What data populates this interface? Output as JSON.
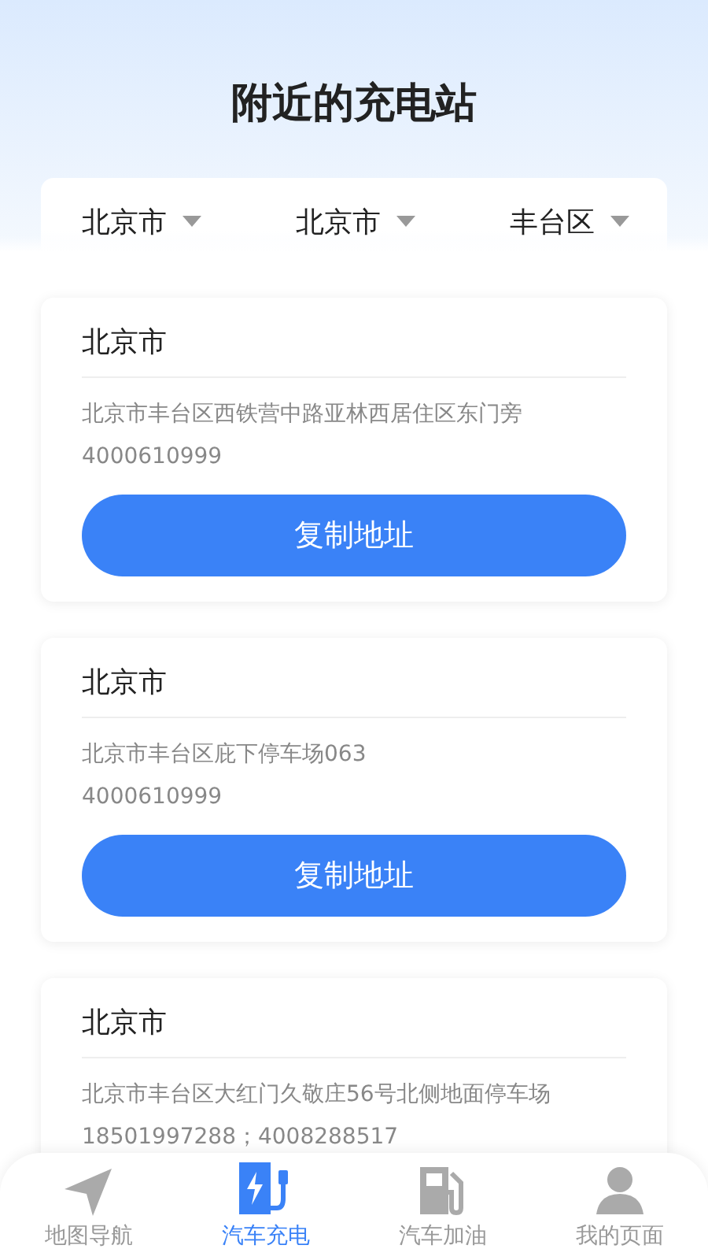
{
  "title": "附近的充电站",
  "filters": [
    {
      "label": "北京市"
    },
    {
      "label": "北京市"
    },
    {
      "label": "丰台区"
    }
  ],
  "stations": [
    {
      "name": "北京市",
      "address": "北京市丰台区西铁营中路亚林西居住区东门旁",
      "phone": "4000610999",
      "button": "复制地址"
    },
    {
      "name": "北京市",
      "address": "北京市丰台区庇下停车场063",
      "phone": "4000610999",
      "button": "复制地址"
    },
    {
      "name": "北京市",
      "address": "北京市丰台区大红门久敬庄56号北侧地面停车场",
      "phone": "18501997288；4008288517"
    }
  ],
  "tabs": [
    {
      "kind": "nav",
      "label": "地图导航",
      "selected": false
    },
    {
      "kind": "charge",
      "label": "汽车充电",
      "selected": true
    },
    {
      "kind": "fuel",
      "label": "汽车加油",
      "selected": false
    },
    {
      "kind": "user",
      "label": "我的页面",
      "selected": false
    }
  ]
}
